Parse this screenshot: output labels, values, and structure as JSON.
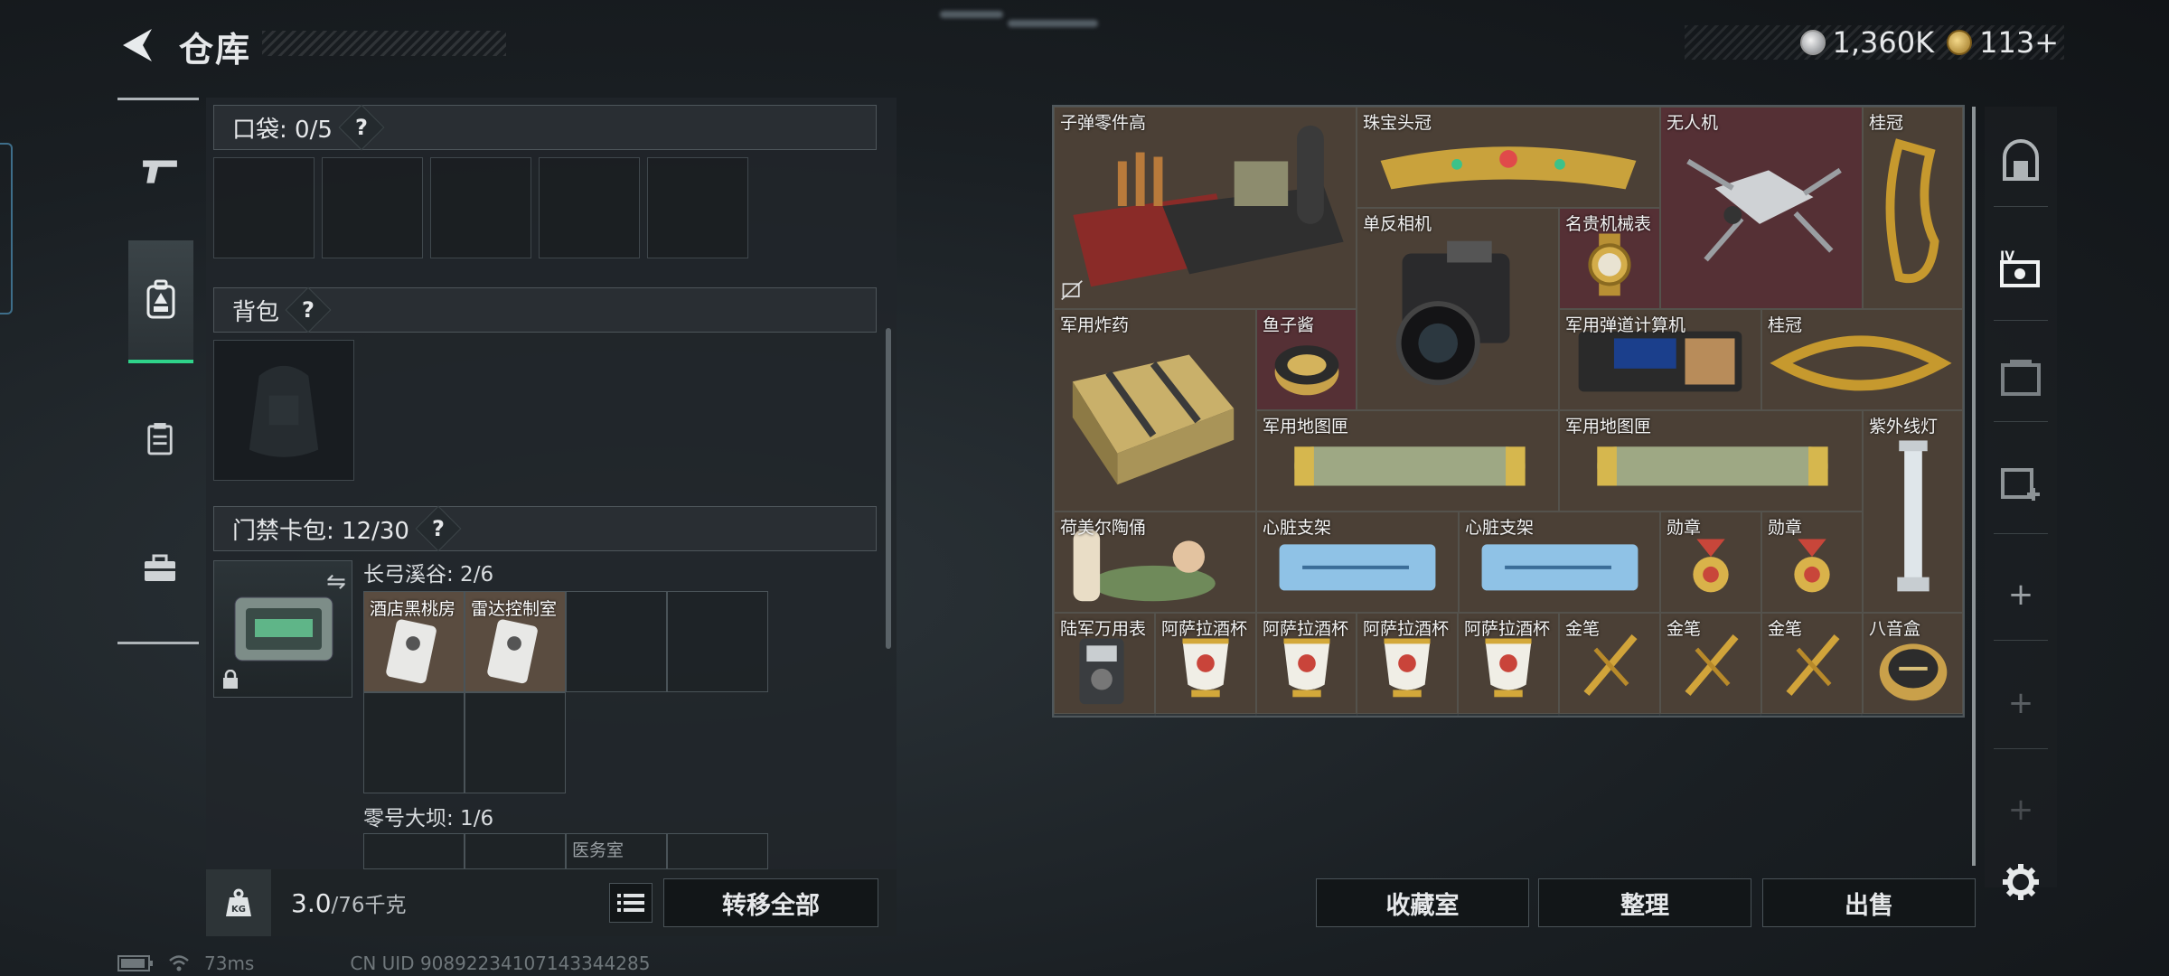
{
  "header": {
    "title": "仓库",
    "currency": [
      {
        "icon": "silver-coin-icon",
        "value": "1,360K"
      },
      {
        "icon": "gold-coin-icon",
        "value": "113+"
      }
    ]
  },
  "left_nav": [
    "pistol-icon",
    "backpack-icon",
    "vest-icon",
    "toolbox-icon"
  ],
  "pocket": {
    "label": "口袋: 0/5",
    "help": "?"
  },
  "backpack": {
    "label": "背包",
    "help": "?"
  },
  "keycard": {
    "label": "门禁卡包: 12/30",
    "help": "?",
    "groups": [
      {
        "title": "长弓溪谷: 2/6",
        "cards": [
          "酒店黑桃房",
          "雷达控制室"
        ]
      },
      {
        "title": "零号大坝: 1/6",
        "cards": [
          "医务室"
        ]
      }
    ]
  },
  "footer": {
    "weight_current": "3.0",
    "weight_max": "/76千克",
    "weight_icon": "KG",
    "transfer_all": "转移全部"
  },
  "status": {
    "ping": "73ms",
    "uid": "CN UID 9089223410714334428​5"
  },
  "stash_items": [
    {
      "name": "子弹零件高",
      "color": "brown"
    },
    {
      "name": "珠宝头冠",
      "color": "brown"
    },
    {
      "name": "无人机",
      "color": "red"
    },
    {
      "name": "桂冠",
      "color": "brown"
    },
    {
      "name": "单反相机",
      "color": "brown"
    },
    {
      "name": "名贵机械表",
      "color": "red"
    },
    {
      "name": "军用炸药",
      "color": "brown"
    },
    {
      "name": "鱼子酱",
      "color": "red"
    },
    {
      "name": "军用弹道计算机",
      "color": "brown"
    },
    {
      "name": "桂冠",
      "color": "brown"
    },
    {
      "name": "军用地图匣",
      "color": "brown"
    },
    {
      "name": "军用地图匣",
      "color": "brown"
    },
    {
      "name": "紫外线灯",
      "color": "brown"
    },
    {
      "name": "荷美尔陶俑",
      "color": "brown"
    },
    {
      "name": "心脏支架",
      "color": "brown"
    },
    {
      "name": "心脏支架",
      "color": "brown"
    },
    {
      "name": "勋章",
      "color": "brown"
    },
    {
      "name": "勋章",
      "color": "brown"
    },
    {
      "name": "陆军万用表",
      "color": "brown"
    },
    {
      "name": "阿萨拉酒杯",
      "color": "brown"
    },
    {
      "name": "阿萨拉酒杯",
      "color": "brown"
    },
    {
      "name": "阿萨拉酒杯",
      "color": "brown"
    },
    {
      "name": "阿萨拉酒杯",
      "color": "brown"
    },
    {
      "name": "金笔",
      "color": "brown"
    },
    {
      "name": "金笔",
      "color": "brown"
    },
    {
      "name": "金笔",
      "color": "brown"
    },
    {
      "name": "八音盒",
      "color": "brown"
    }
  ],
  "actions": {
    "collection": "收藏室",
    "sort": "整理",
    "sell": "出售"
  },
  "right_nav": [
    "vault-icon",
    "stash-icon",
    "stash-locked-icon",
    "stash-add-icon",
    "plus-icon",
    "plus-icon",
    "plus-icon",
    "settings-icon"
  ],
  "colors": {
    "accent_green": "#2fd38a",
    "item_brown": "#4b4036",
    "item_red": "#553035"
  }
}
